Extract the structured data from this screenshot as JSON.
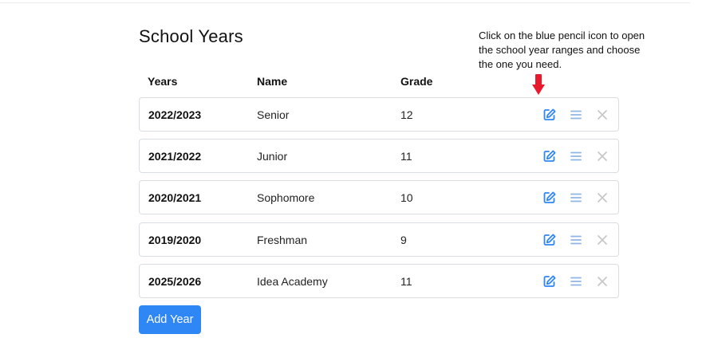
{
  "page": {
    "title": "School Years",
    "instruction": "Click on the blue pencil icon to open the school year ranges and choose the one you need."
  },
  "table": {
    "headers": {
      "years": "Years",
      "name": "Name",
      "grade": "Grade"
    },
    "rows": [
      {
        "years": "2022/2023",
        "name": "Senior",
        "grade": "12"
      },
      {
        "years": "2021/2022",
        "name": "Junior",
        "grade": "11"
      },
      {
        "years": "2020/2021",
        "name": "Sophomore",
        "grade": "10"
      },
      {
        "years": "2019/2020",
        "name": "Freshman",
        "grade": "9"
      },
      {
        "years": "2025/2026",
        "name": "Idea Academy",
        "grade": "11"
      }
    ]
  },
  "actions": {
    "add_year_label": "Add Year"
  },
  "icons": {
    "edit": "pencil-square-icon",
    "reorder": "bars-icon",
    "delete": "close-icon",
    "annotation": "red-arrow-down-icon"
  },
  "colors": {
    "primary": "#2f86f5",
    "edit_icon": "#2f86f5",
    "muted_icon": "#8fb4e6",
    "delete_icon": "#c8c8c8",
    "arrow": "#e8192c"
  }
}
